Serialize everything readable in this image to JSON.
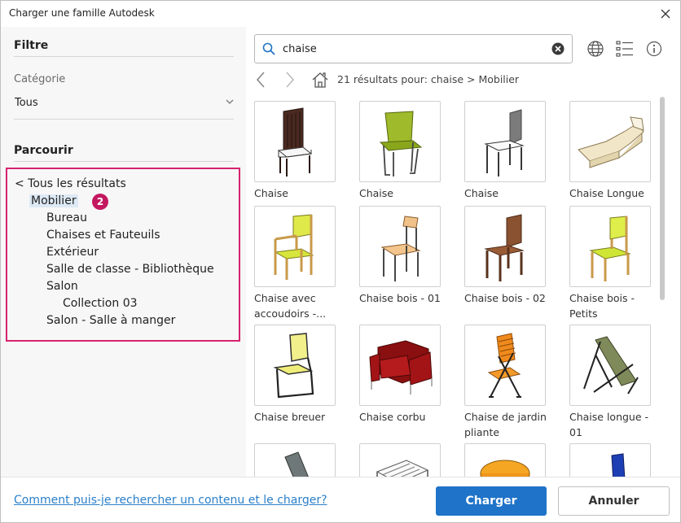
{
  "window": {
    "title": "Charger une famille Autodesk"
  },
  "filter": {
    "title": "Filtre",
    "category_label": "Catégorie",
    "category_value": "Tous"
  },
  "browse": {
    "title": "Parcourir",
    "badge": "2",
    "items": [
      {
        "label": "< Tous les résultats",
        "level": 0
      },
      {
        "label": "Mobilier",
        "level": 1,
        "selected": true
      },
      {
        "label": "Bureau",
        "level": 2
      },
      {
        "label": "Chaises et Fauteuils",
        "level": 2
      },
      {
        "label": "Extérieur",
        "level": 2
      },
      {
        "label": "Salle de classe - Bibliothèque",
        "level": 2
      },
      {
        "label": "Salon",
        "level": 2
      },
      {
        "label": "Collection 03",
        "level": 3
      },
      {
        "label": "Salon - Salle à manger",
        "level": 2
      }
    ]
  },
  "search": {
    "value": "chaise"
  },
  "results": {
    "summary": "21 résultats  pour: chaise > Mobilier",
    "items": [
      {
        "label1": "Chaise",
        "label2": "",
        "icon": "dark-wood-chair-icon"
      },
      {
        "label1": "Chaise",
        "label2": "",
        "icon": "green-chair-icon"
      },
      {
        "label1": "Chaise",
        "label2": "",
        "icon": "grey-chair-icon"
      },
      {
        "label1": "Chaise Longue",
        "label2": "",
        "icon": "chaise-longue-icon"
      },
      {
        "label1": "Chaise avec",
        "label2": "accoudoirs -...",
        "icon": "armchair-yellow-icon"
      },
      {
        "label1": "Chaise bois - 01",
        "label2": "",
        "icon": "wood-chair-01-icon"
      },
      {
        "label1": "Chaise bois - 02",
        "label2": "",
        "icon": "wood-chair-02-icon"
      },
      {
        "label1": "Chaise bois -",
        "label2": "Petits",
        "icon": "wood-chair-small-icon"
      },
      {
        "label1": "Chaise breuer",
        "label2": "",
        "icon": "breuer-chair-icon"
      },
      {
        "label1": "Chaise corbu",
        "label2": "",
        "icon": "corbu-armchair-icon"
      },
      {
        "label1": "Chaise de jardin",
        "label2": "pliante",
        "icon": "garden-chair-icon"
      },
      {
        "label1": "Chaise longue -",
        "label2": "01",
        "icon": "deck-chair-icon"
      },
      {
        "label1": "",
        "label2": "",
        "icon": "grey-seat-icon"
      },
      {
        "label1": "",
        "label2": "",
        "icon": "bench-icon"
      },
      {
        "label1": "",
        "label2": "",
        "icon": "orange-tub-chair-icon"
      },
      {
        "label1": "",
        "label2": "",
        "icon": "blue-chair-icon"
      }
    ]
  },
  "footer": {
    "help_link": "Comment puis-je rechercher un contenu et le charger?",
    "load_label": "Charger",
    "cancel_label": "Annuler"
  },
  "colors": {
    "primary": "#1f73c8",
    "highlight": "#d6226f",
    "badge": "#c3185f",
    "link": "#2a7fc9"
  }
}
